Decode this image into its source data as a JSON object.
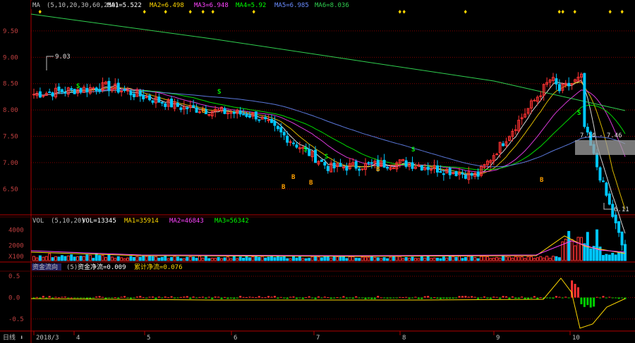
{
  "colors": {
    "up": "#ff3232",
    "down": "#00c8ff",
    "ma1": "#ffffff",
    "ma2": "#ffd700",
    "ma3": "#ff44ff",
    "ma4": "#00ff00",
    "ma5": "#6a8cff",
    "ma6": "#30d050",
    "grid": "#800000",
    "axis": "#b00000",
    "marker": "#ffd700"
  },
  "legend": {
    "main": {
      "name": "MA",
      "params": "(5,10,20,30,60,250)",
      "items": [
        "MA1=5.522",
        "MA2=6.498",
        "MA3=6.948",
        "MA4=5.92",
        "MA5=6.985",
        "MA6=8.036"
      ]
    },
    "vol": {
      "name": "VOL",
      "params": "(5,10,20)",
      "items": [
        "VOL=13345",
        "MA1=35914",
        "MA2=46843",
        "MA3=56342"
      ]
    },
    "fund": {
      "name": "资金流向",
      "params": "(5)",
      "items": [
        "资金净流=0.009",
        "累计净流=0.076"
      ]
    }
  },
  "labels": {
    "high": "9.03",
    "low": "6.11",
    "range": "7.14 - 7.46",
    "b_mark": "B",
    "s_mark": "S",
    "period_button": "日线"
  },
  "chart_data": [
    {
      "type": "candlestick",
      "panel": "price",
      "yticks": [
        "9.50",
        "9.00",
        "8.50",
        "8.00",
        "7.50",
        "7.00",
        "6.50"
      ],
      "ylim": [
        6.05,
        9.9
      ],
      "x_labels": [
        "2018/3",
        "4",
        "5",
        "6",
        "7",
        "8",
        "9",
        "10"
      ],
      "annotations": {
        "high": 9.03,
        "low": 6.11,
        "range": "7.14 - 7.46"
      },
      "key_points": [
        {
          "month": "2018/3",
          "close": 8.3
        },
        {
          "month": "4",
          "close": 8.45
        },
        {
          "month": "5",
          "close": 8.05
        },
        {
          "month": "6",
          "close": 7.9
        },
        {
          "month": "7",
          "close": 6.9
        },
        {
          "month": "8",
          "close": 7.0
        },
        {
          "month": "9",
          "close": 6.75
        },
        {
          "month": "10",
          "close": 8.6
        },
        {
          "month": "end",
          "close": 6.55
        }
      ]
    },
    {
      "type": "bar",
      "panel": "volume",
      "yticks": [
        "4000",
        "2000",
        "X100"
      ],
      "ylim": [
        0,
        4600
      ]
    },
    {
      "type": "bar",
      "panel": "fund-flow",
      "yticks": [
        "0.5",
        "0.0",
        "-0.5"
      ],
      "ylim": [
        -0.75,
        0.6
      ]
    }
  ]
}
